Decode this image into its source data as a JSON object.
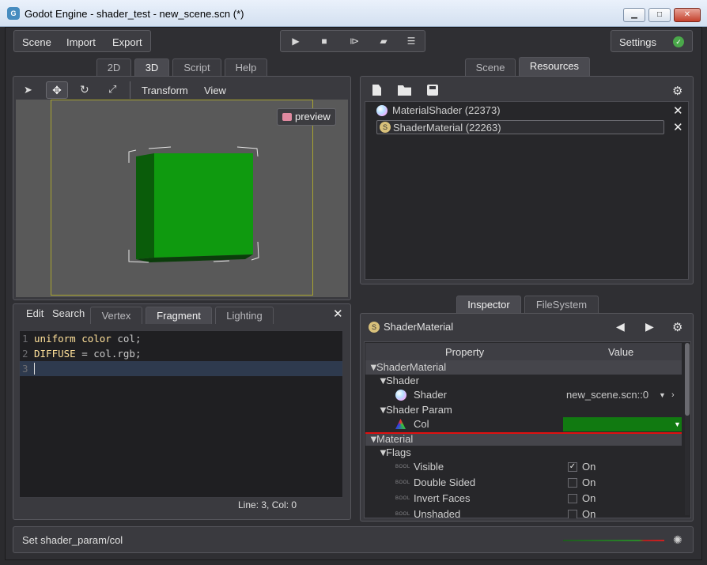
{
  "window": {
    "title": "Godot Engine - shader_test - new_scene.scn (*)",
    "min_label": "▁",
    "max_label": "□",
    "close_label": "✕"
  },
  "menu": {
    "scene": "Scene",
    "import": "Import",
    "export": "Export",
    "settings": "Settings"
  },
  "playback": {
    "icons": [
      "play-icon",
      "stop-icon",
      "play-scene-icon",
      "open-folder-icon",
      "list-icon"
    ]
  },
  "left_tabs": [
    "2D",
    "3D",
    "Script",
    "Help"
  ],
  "active_left_tab": "3D",
  "viewport_toolbar": {
    "transform": "Transform",
    "view": "View"
  },
  "viewport": {
    "preview_label": "preview",
    "cube_color": "#0f9a0f",
    "cube_side_color": "#0a5c0a"
  },
  "editor_tabs": {
    "edit": "Edit",
    "search": "Search",
    "shader_tabs": [
      "Vertex",
      "Fragment",
      "Lighting"
    ],
    "active": "Fragment"
  },
  "code": {
    "lines": [
      {
        "num": "1",
        "keyword": "uniform color",
        "rest": " col;"
      },
      {
        "num": "2",
        "keyword": "DIFFUSE",
        "rest": " = col.rgb;"
      },
      {
        "num": "3",
        "keyword": "",
        "rest": ""
      }
    ],
    "status": "Line: 3, Col: 0"
  },
  "right_top_tabs": [
    "Scene",
    "Resources"
  ],
  "active_right_top_tab": "Resources",
  "resources": [
    {
      "label": "MaterialShader (22373)",
      "selected": false
    },
    {
      "label": "ShaderMaterial (22263)",
      "selected": true
    }
  ],
  "right_bottom_tabs": [
    "Inspector",
    "FileSystem"
  ],
  "active_right_bottom_tab": "Inspector",
  "inspector": {
    "object": "ShaderMaterial",
    "header_property": "Property",
    "header_value": "Value",
    "rows": {
      "shadermaterial": "ShaderMaterial",
      "shader_cat": "Shader",
      "shader_prop": "Shader",
      "shader_value": "new_scene.scn::0",
      "shader_param": "Shader Param",
      "col": "Col",
      "col_color": "#117a11",
      "material": "Material",
      "flags": "Flags",
      "bool_tag": "BOOL",
      "visible": "Visible",
      "double_sided": "Double Sided",
      "invert_faces": "Invert Faces",
      "unshaded": "Unshaded",
      "on": "On"
    }
  },
  "status_bar": {
    "text": "Set shader_param/col"
  }
}
